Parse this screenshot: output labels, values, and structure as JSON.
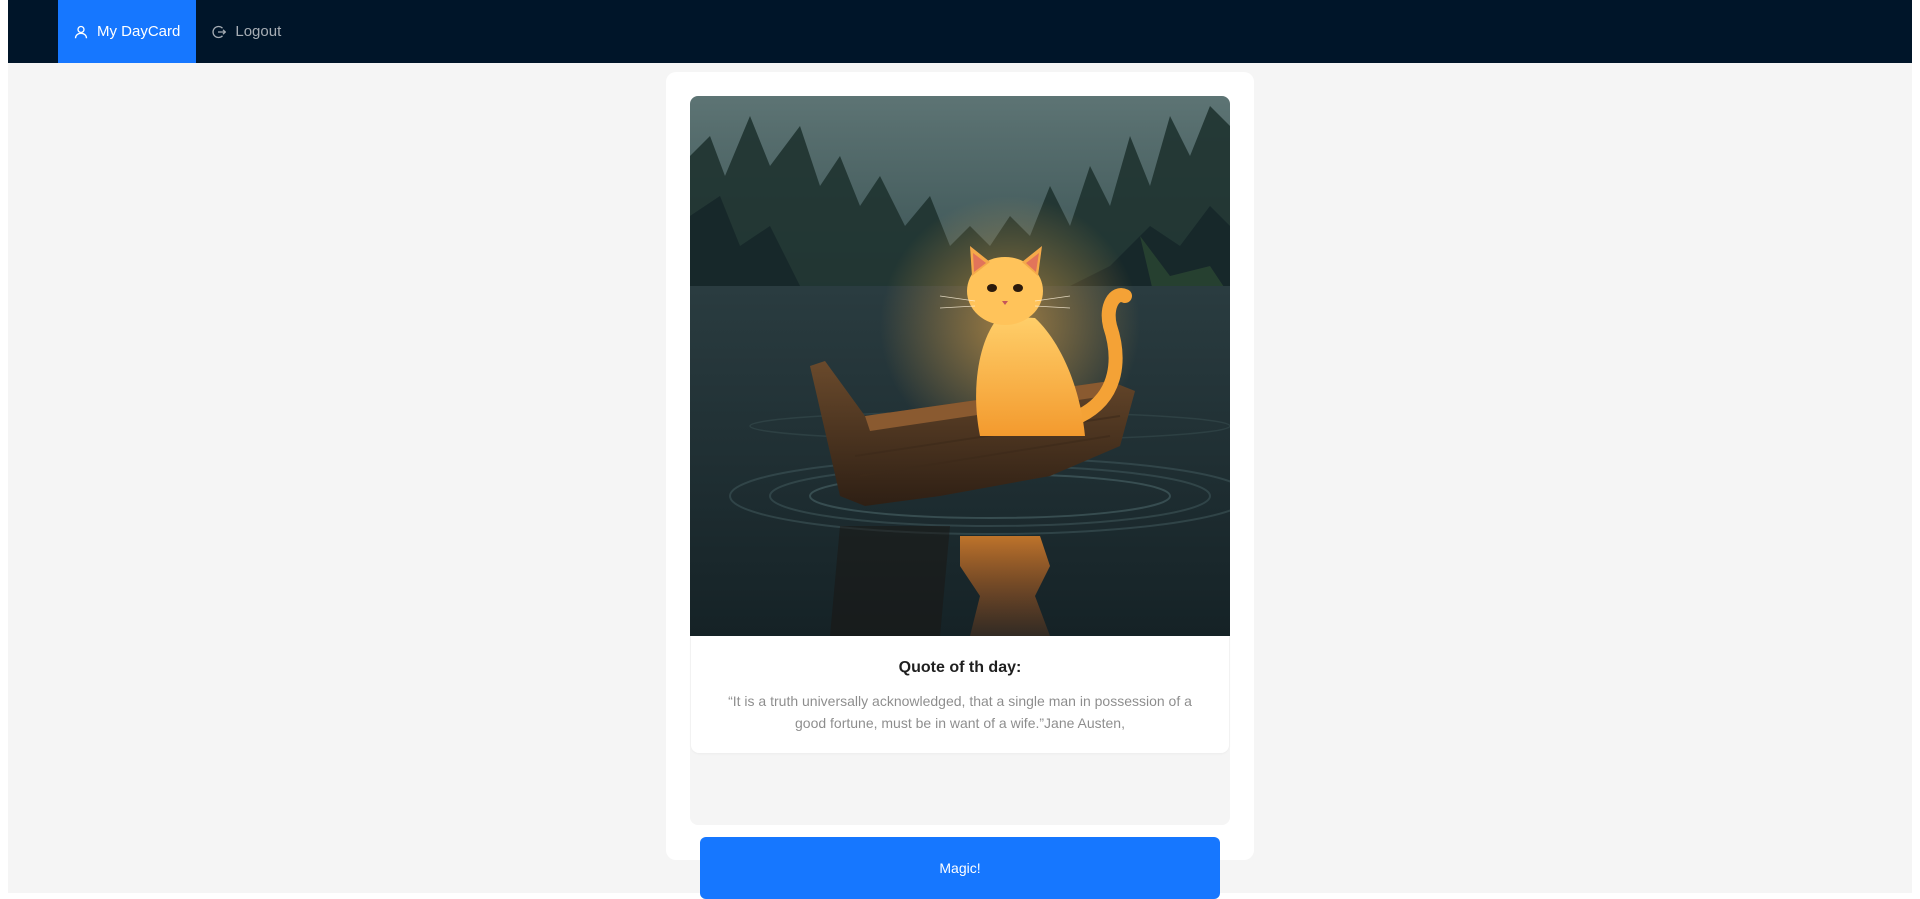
{
  "nav": {
    "items": [
      {
        "label": "My DayCard",
        "icon": "user-icon",
        "active": true
      },
      {
        "label": "Logout",
        "icon": "logout-icon",
        "active": false
      }
    ]
  },
  "card": {
    "image": {
      "icon": "cat-in-boat-image"
    },
    "quote_title": "Quote of th day:",
    "quote_text": "“It is a truth universally acknowledged, that a single man in possession of a good fortune, must be in want of a wife.”Jane Austen,",
    "button_label": "Magic!"
  },
  "colors": {
    "header_bg": "#001529",
    "accent": "#1677ff",
    "page_bg": "#f5f5f5"
  }
}
